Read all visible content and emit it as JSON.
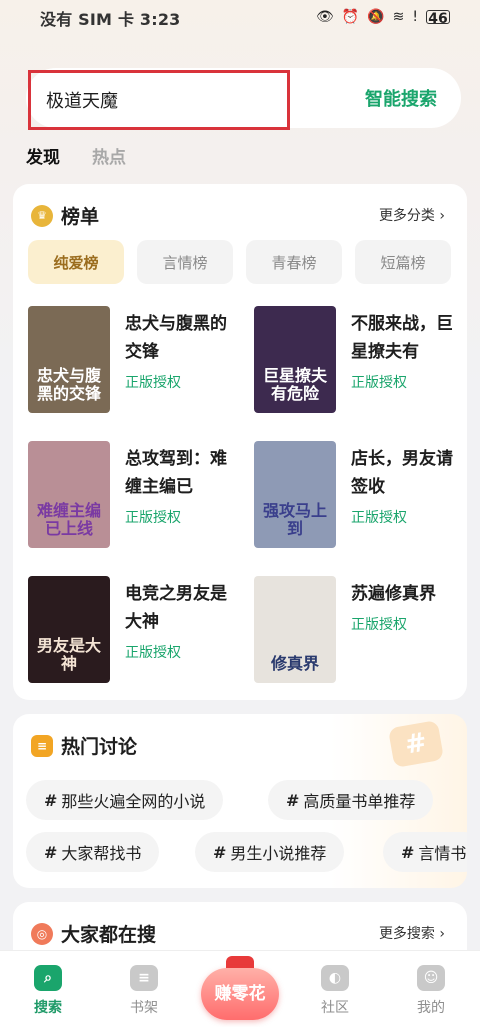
{
  "status_bar": {
    "text": "没有 SIM 卡 3:23",
    "battery": "46"
  },
  "search": {
    "value": "极道天魔",
    "button": "智能搜索"
  },
  "top_tabs": [
    "发现",
    "热点"
  ],
  "rank": {
    "title": "榜单",
    "more": "更多分类 ›",
    "chips": [
      "纯爱榜",
      "言情榜",
      "青春榜",
      "短篇榜"
    ],
    "books": [
      {
        "title": "忠犬与腹黑的交锋",
        "license": "正版授权",
        "cover_text": "忠犬与腹黑的交锋",
        "cover_bg": "#7b6a55",
        "cover_fg": "#ffffff"
      },
      {
        "title": "不服来战，巨星撩夫有",
        "license": "正版授权",
        "cover_text": "巨星撩夫有危险",
        "cover_bg": "#3d2a4f",
        "cover_fg": "#ffffff"
      },
      {
        "title": "总攻驾到：难缠主编已",
        "license": "正版授权",
        "cover_text": "难缠主编已上线",
        "cover_bg": "#b98f96",
        "cover_fg": "#7a3aa3"
      },
      {
        "title": "店长，男友请签收",
        "license": "正版授权",
        "cover_text": "强攻马上到",
        "cover_bg": "#8e9ab5",
        "cover_fg": "#3a3f8c"
      },
      {
        "title": "电竞之男友是大神",
        "license": "正版授权",
        "cover_text": "男友是大神",
        "cover_bg": "#2a1b1e",
        "cover_fg": "#f4e4d4"
      },
      {
        "title": "苏遍修真界",
        "license": "正版授权",
        "cover_text": "修真界",
        "cover_bg": "#e7e3dd",
        "cover_fg": "#2a3a6e"
      }
    ]
  },
  "discuss": {
    "title": "热门讨论",
    "topics": [
      "那些火遍全网的小说",
      "高质量书单推荐",
      "大家帮找书",
      "男生小说推荐",
      "言情书"
    ]
  },
  "popular_search": {
    "title": "大家都在搜",
    "more": "更多搜索 ›"
  },
  "nav": {
    "items": [
      "搜索",
      "书架",
      "社区",
      "我的"
    ],
    "earn": "赚零花"
  },
  "colors": {
    "accent_green": "#1aa56c",
    "highlight_red": "#d9333b"
  }
}
